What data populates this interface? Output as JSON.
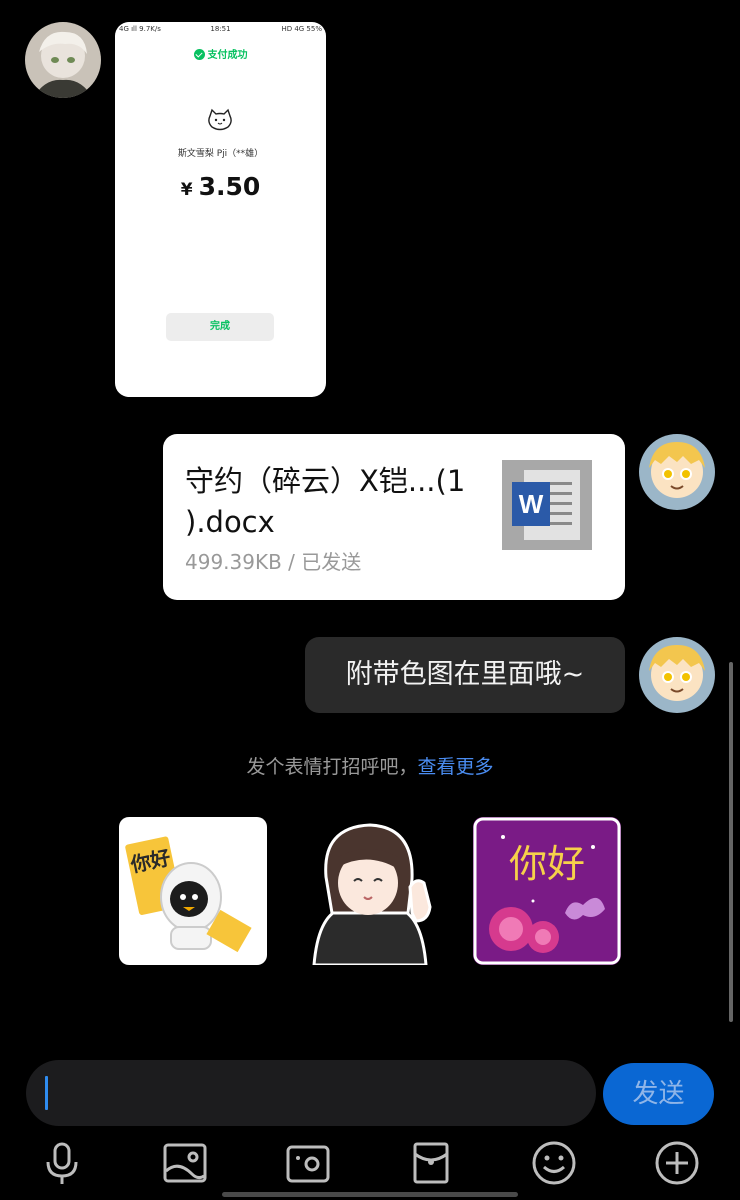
{
  "screenshot": {
    "status_left": "4G ıll 9.7K/s",
    "time": "18:51",
    "status_right": "HD 4G 55%",
    "title": "支付成功",
    "merchant": "斯文雪梨 Pji（**雄）",
    "currency": "¥",
    "amount": "3.50",
    "done": "完成"
  },
  "file": {
    "name_line1": "守约（碎云）X铠...(1",
    "name_line2": ").docx",
    "meta": "499.39KB  /  已发送",
    "icon": "word-doc-icon"
  },
  "text_message": "附带色图在里面哦~",
  "hint": {
    "text": "发个表情打招呼吧，",
    "link": "查看更多"
  },
  "stickers": [
    {
      "name": "qq-penguin-hello-sticker",
      "text": "你好"
    },
    {
      "name": "anime-girl-wave-sticker"
    },
    {
      "name": "purple-flower-hello-sticker",
      "text": "你好"
    }
  ],
  "composer": {
    "send": "发送"
  },
  "toolbar": [
    "microphone-icon",
    "image-icon",
    "camera-icon",
    "red-packet-icon",
    "emoji-icon",
    "plus-icon"
  ],
  "colors": {
    "accent": "#2f8cf0",
    "wechat_green": "#07c160",
    "send_button": "#0a67d3"
  }
}
